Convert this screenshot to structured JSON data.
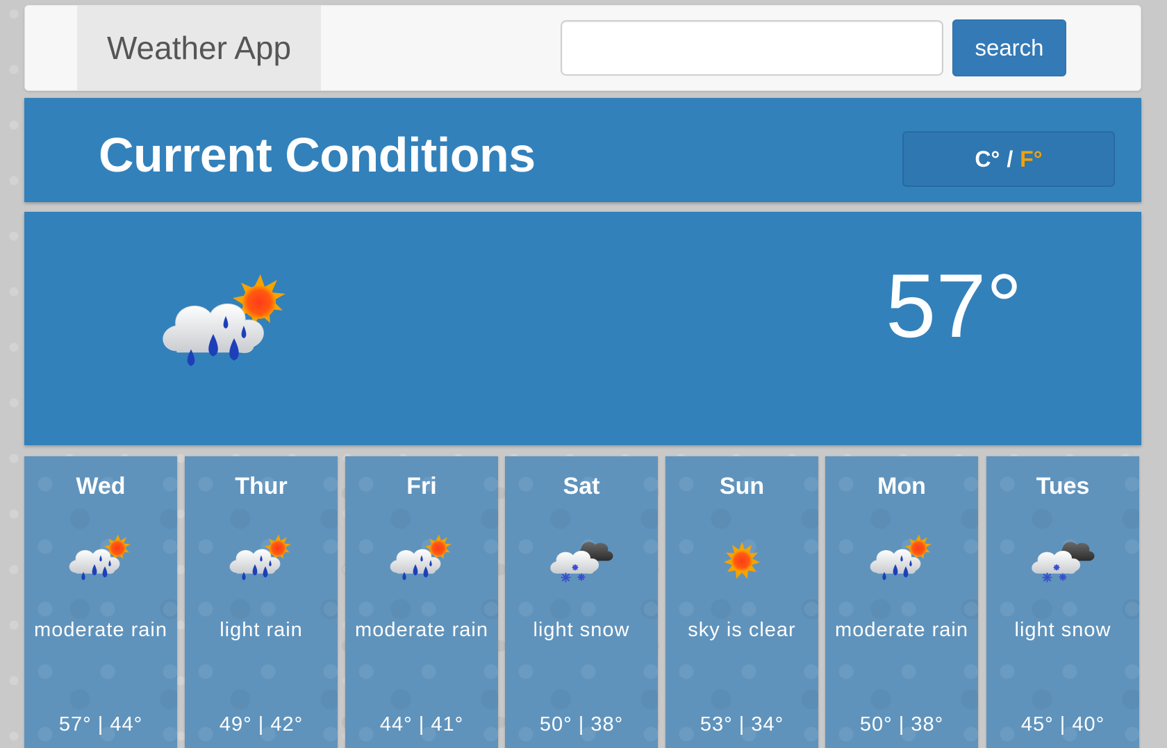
{
  "navbar": {
    "brand": "Weather App",
    "search_value": "",
    "search_placeholder": "",
    "search_label": "search"
  },
  "conditions": {
    "title": "Current Conditions",
    "unit_c": "C°",
    "unit_sep": "/",
    "unit_f": "F°",
    "active_unit": "F",
    "temperature": "57°",
    "icon": "rain-cloud-sun-icon"
  },
  "forecast": [
    {
      "day": "Wed",
      "icon": "rain-cloud-sun-icon",
      "description": "moderate rain",
      "temps": "57° | 44°"
    },
    {
      "day": "Thur",
      "icon": "rain-cloud-sun-icon",
      "description": "light rain",
      "temps": "49° | 42°"
    },
    {
      "day": "Fri",
      "icon": "rain-cloud-sun-icon",
      "description": "moderate rain",
      "temps": "44° | 41°"
    },
    {
      "day": "Sat",
      "icon": "snow-cloud-icon",
      "description": "light snow",
      "temps": "50° | 38°"
    },
    {
      "day": "Sun",
      "icon": "sun-icon",
      "description": "sky is clear",
      "temps": "53° | 34°"
    },
    {
      "day": "Mon",
      "icon": "rain-cloud-sun-icon",
      "description": "moderate rain",
      "temps": "50° | 38°"
    },
    {
      "day": "Tues",
      "icon": "snow-cloud-icon",
      "description": "light snow",
      "temps": "45° | 40°"
    }
  ],
  "colors": {
    "primary_blue": "#3281bb",
    "button_blue": "#337ab7",
    "card_blue": "#5f93bc",
    "accent_orange": "#f0a30a"
  }
}
